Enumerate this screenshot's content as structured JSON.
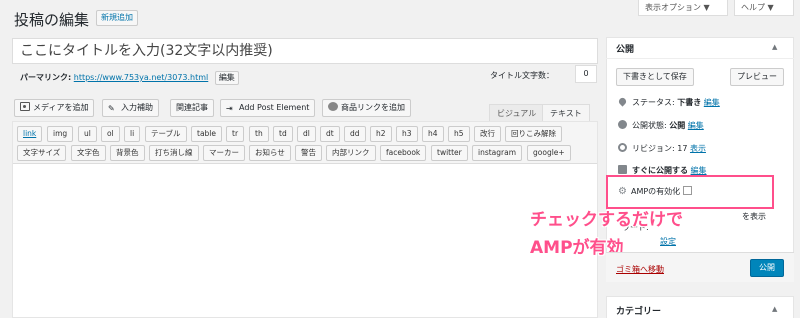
{
  "header": {
    "page_title": "投稿の編集",
    "add_new": "新規追加",
    "screen_options": "表示オプション ▼",
    "help": "ヘルプ ▼"
  },
  "title_field": {
    "value": "ここにタイトルを入力(32文字以内推奨)"
  },
  "permalink": {
    "label": "パーマリンク:",
    "url": "https://www.753ya.net/3073.html",
    "edit": "編集"
  },
  "title_count": {
    "label": "タイトル文字数：",
    "value": "0"
  },
  "media_buttons": [
    {
      "label": "メディアを追加",
      "icon": "media-icon"
    },
    {
      "label": "入力補助",
      "icon": "pencil-icon"
    },
    {
      "label": "関連記事"
    },
    {
      "label": "Add Post Element",
      "icon": "element-icon"
    },
    {
      "label": "商品リンクを追加",
      "icon": "product-icon"
    }
  ],
  "tabs": {
    "visual": "ビジュアル",
    "text": "テキスト"
  },
  "quicktags_row1": [
    "link",
    "img",
    "ul",
    "ol",
    "li",
    "テーブル",
    "table",
    "tr",
    "th",
    "td",
    "dl",
    "dt",
    "dd",
    "h2",
    "h3",
    "h4",
    "h5",
    "改行",
    "回りこみ解除"
  ],
  "quicktags_row2": [
    "文字サイズ",
    "文字色",
    "背景色",
    "打ち消し線",
    "マーカー",
    "お知らせ",
    "警告",
    "内部リンク",
    "facebook",
    "twitter",
    "instagram",
    "google+"
  ],
  "publish_box": {
    "title": "公開",
    "arrow": "▲",
    "save_draft": "下書きとして保存",
    "preview": "プレビュー",
    "status": {
      "label": "ステータス: ",
      "value": "下書き",
      "link": "編集"
    },
    "visibility": {
      "label": "公開状態: ",
      "value": "公開",
      "link": "編集"
    },
    "revisions": {
      "label": "リビジョン: 17 ",
      "link": "表示"
    },
    "schedule": {
      "label": "すぐに公開する",
      "link": "編集"
    },
    "amp": {
      "label": "AMPの有効化"
    },
    "partial_1": "を表示",
    "partial_2": "ワード:",
    "partial_3_link": "設定",
    "trash": "ゴミ箱へ移動",
    "publish": "公開"
  },
  "annotation": {
    "line1": "チェックするだけで",
    "line2": "AMPが有効"
  },
  "category_box": {
    "title": "カテゴリー",
    "arrow": "▲"
  },
  "colors": {
    "accent": "#0073aa",
    "publish": "#0085ba",
    "annotation": "#ff4f8b"
  }
}
